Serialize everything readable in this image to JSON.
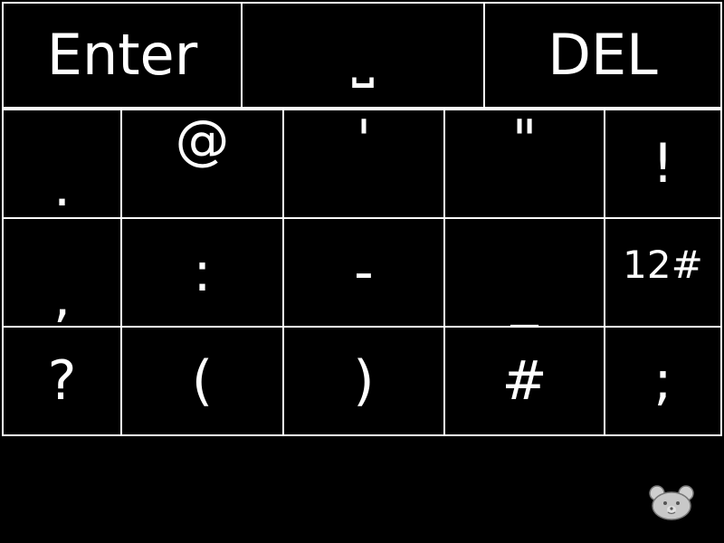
{
  "keyboard": {
    "top_row": {
      "enter_label": "Enter",
      "space_symbol": "⎵",
      "delete_label": "DEL"
    },
    "rows": [
      [
        ".",
        "@",
        "'",
        "\"",
        "!"
      ],
      [
        ",",
        ":",
        "-",
        "_",
        "12#"
      ],
      [
        "?",
        "(",
        ")",
        "#",
        ";"
      ]
    ]
  },
  "colors": {
    "background": "#000000",
    "key_border": "#FFFFFF",
    "key_text": "#FFFFFF",
    "mascot_fill": "#C8C8C8"
  },
  "icons": {
    "space": "space-bar-icon",
    "mascot": "bear-icon"
  }
}
